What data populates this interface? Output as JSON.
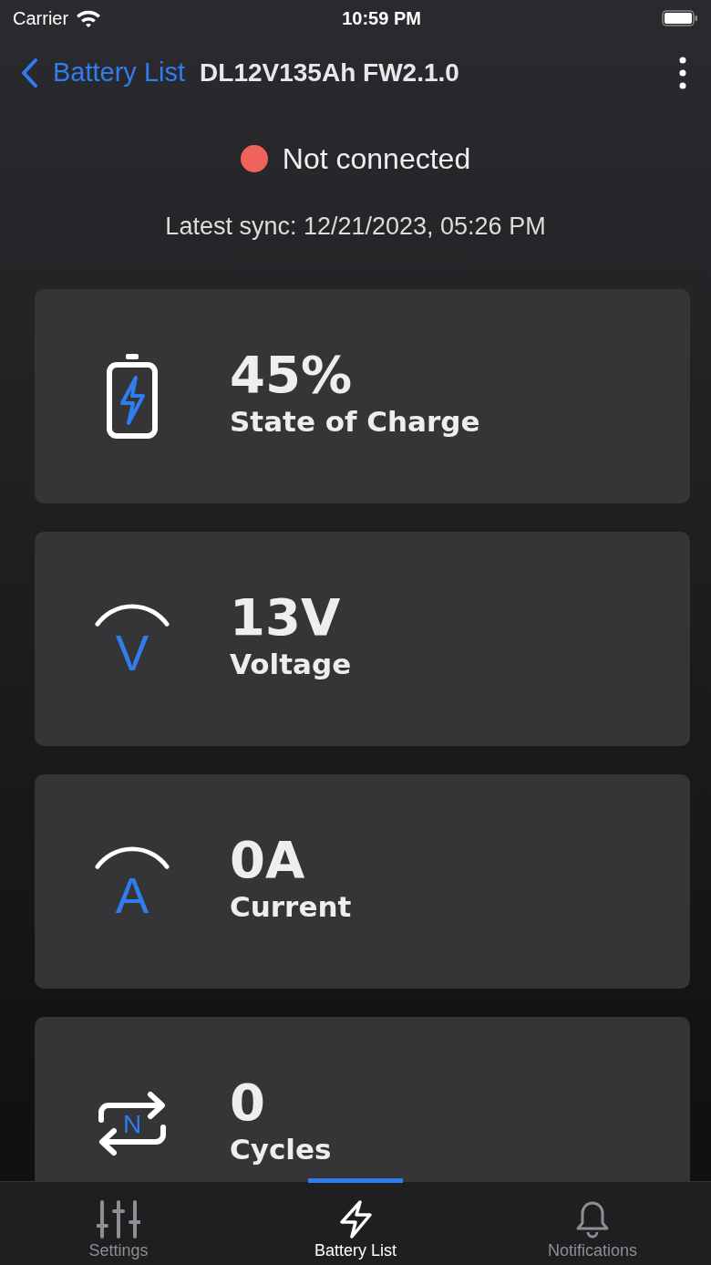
{
  "status_bar": {
    "carrier": "Carrier",
    "time": "10:59 PM"
  },
  "nav": {
    "back_label": "Battery List",
    "title": "DL12V135Ah FW2.1.0"
  },
  "connection": {
    "label": "Not connected",
    "color": "#f0635a",
    "sync": "Latest sync: 12/21/2023, 05:26 PM"
  },
  "cards": [
    {
      "kind": "battery",
      "value": "45%",
      "label": "State of Charge"
    },
    {
      "kind": "gauge",
      "icon_letter": "V",
      "value": "13V",
      "label": "Voltage"
    },
    {
      "kind": "gauge",
      "icon_letter": "A",
      "value": "0A",
      "label": "Current"
    },
    {
      "kind": "cycle",
      "icon_letter": "N",
      "value": "0",
      "label": "Cycles"
    }
  ],
  "tabs": [
    {
      "kind": "settings",
      "label": "Settings",
      "selected": false
    },
    {
      "kind": "bolt",
      "label": "Battery List",
      "selected": true
    },
    {
      "kind": "bell",
      "label": "Notifications",
      "selected": false
    }
  ]
}
